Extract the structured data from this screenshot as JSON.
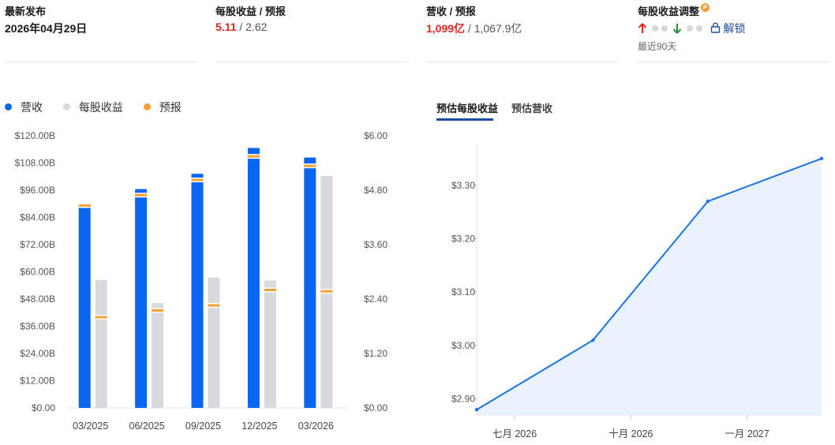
{
  "stats": {
    "latest": {
      "label": "最新发布",
      "value": "2026年04月29日"
    },
    "eps": {
      "label": "每股收益 / 预报",
      "actual": "5.11",
      "sep": " / ",
      "forecast": "2.62"
    },
    "revenue": {
      "label": "营收 / 预报",
      "actual": "1,099亿",
      "sep": " / ",
      "forecast": "1,067.9亿"
    },
    "eps_revision": {
      "label": "每股收益调整",
      "badge": "P",
      "unlock": "解锁",
      "period": "最近90天",
      "up_icon": "arrow-up-icon",
      "down_icon": "arrow-down-icon",
      "lock_icon": "lock-icon"
    }
  },
  "legend": [
    {
      "label": "营收",
      "color": "#0a66f0"
    },
    {
      "label": "每股收益",
      "color": "#d8dadd"
    },
    {
      "label": "预报",
      "color": "#f5a132"
    }
  ],
  "tabs": [
    {
      "label": "预估每股收益",
      "active": true
    },
    {
      "label": "预估营收",
      "active": false
    }
  ],
  "colors": {
    "revenue": "#0a66f0",
    "eps": "#d8dadd",
    "forecast": "#f5a132",
    "line": "#1a73e8",
    "area": "#eaf2fd"
  },
  "chart_data": [
    {
      "type": "bar",
      "categories": [
        "03/2025",
        "06/2025",
        "09/2025",
        "12/2025",
        "03/2026"
      ],
      "series": [
        {
          "name": "营收",
          "axis": "left",
          "values": [
            90.2,
            96.5,
            103.2,
            114.6,
            110.4
          ],
          "forecast": [
            89.2,
            93.8,
            100.5,
            110.9,
            106.7
          ]
        },
        {
          "name": "每股收益",
          "axis": "right",
          "values": [
            2.82,
            2.31,
            2.87,
            2.81,
            5.11
          ],
          "forecast": [
            2.0,
            2.15,
            2.26,
            2.6,
            2.57
          ]
        }
      ],
      "y_left": {
        "ticks": [
          "$0.00",
          "$12.00B",
          "$24.00B",
          "$36.00B",
          "$48.00B",
          "$60.00B",
          "$72.00B",
          "$84.00B",
          "$96.00B",
          "$108.00B",
          "$120.00B"
        ],
        "ylim": [
          0,
          120
        ]
      },
      "y_right": {
        "ticks": [
          "$0.00",
          "$1.20",
          "$2.40",
          "$3.60",
          "$4.80",
          "$6.00"
        ],
        "ylim": [
          0,
          6
        ]
      },
      "grid": false
    },
    {
      "type": "area",
      "x": [
        "2026-06",
        "2026-09",
        "2026-12",
        "2027-03"
      ],
      "y": [
        2.88,
        3.01,
        3.27,
        3.35
      ],
      "x_ticks": [
        "七月 2026",
        "十月 2026",
        "一月 2027"
      ],
      "y_ticks": [
        "$2.90",
        "$3.00",
        "$3.10",
        "$3.20",
        "$3.30"
      ],
      "ylim": [
        2.87,
        3.375
      ],
      "grid": false
    }
  ]
}
